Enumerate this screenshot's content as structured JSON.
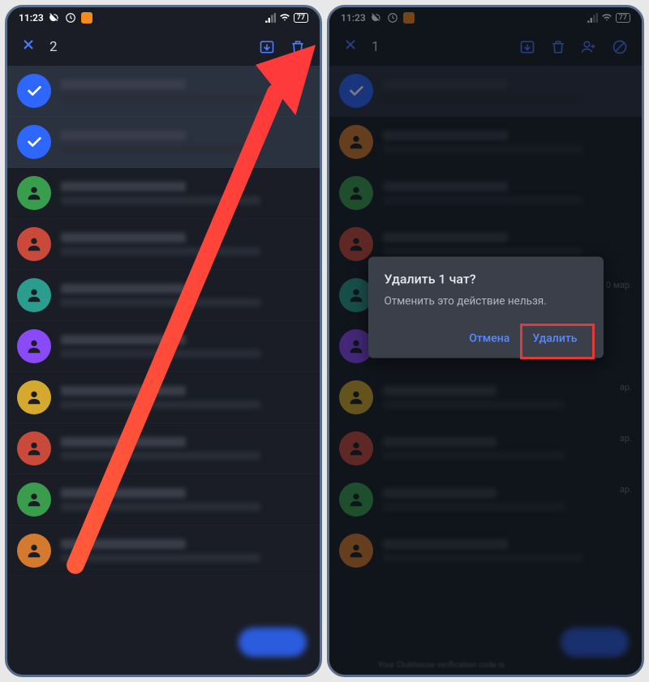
{
  "statusbar": {
    "time": "11:23",
    "battery": "77"
  },
  "left": {
    "selected_count": "2",
    "items": [
      {
        "avatar": "check",
        "selected": true
      },
      {
        "avatar": "check",
        "selected": true
      },
      {
        "avatar": "green"
      },
      {
        "avatar": "red"
      },
      {
        "avatar": "teal"
      },
      {
        "avatar": "purple"
      },
      {
        "avatar": "yellow"
      },
      {
        "avatar": "red"
      },
      {
        "avatar": "green"
      },
      {
        "avatar": "orange"
      }
    ]
  },
  "right": {
    "selected_count": "1",
    "dialog": {
      "title": "Удалить 1 чат?",
      "message": "Отменить это действие нельзя.",
      "cancel": "Отмена",
      "confirm": "Удалить"
    },
    "items": [
      {
        "avatar": "check",
        "selected": true
      },
      {
        "avatar": "orange"
      },
      {
        "avatar": "green",
        "date": ""
      },
      {
        "avatar": "red",
        "date": ""
      },
      {
        "avatar": "teal",
        "date": "0 мар."
      },
      {
        "avatar": "purple",
        "date": ""
      },
      {
        "avatar": "yellow",
        "date": "ар."
      },
      {
        "avatar": "red",
        "date": "ар."
      },
      {
        "avatar": "green",
        "date": "ар."
      },
      {
        "avatar": "orange",
        "date": ""
      }
    ]
  }
}
